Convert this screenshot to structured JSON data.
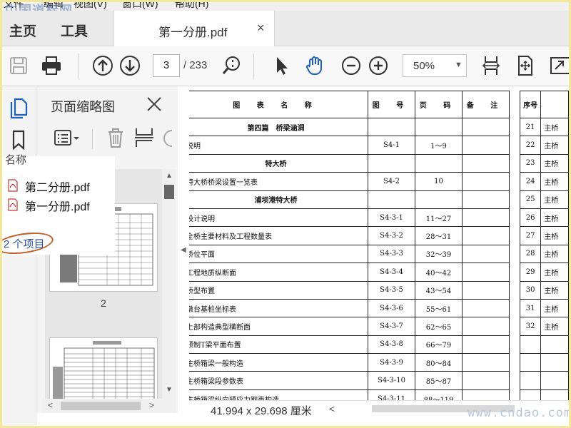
{
  "watermark_top": "中国道标网",
  "watermark_bottom": "www.cndao.com",
  "menu": {
    "items": [
      "文件",
      "编辑",
      "视图(V)",
      "窗口(W)",
      "帮助(H)"
    ]
  },
  "tabs": {
    "home": "主页",
    "tools": "工具",
    "doc": "第一分册.pdf",
    "close": "×"
  },
  "toolbar": {
    "current_page": "3",
    "total_pages": "/ 233",
    "zoom": "50%"
  },
  "thumb_panel": {
    "title": "页面缩略图",
    "page_label": "2"
  },
  "file_list": {
    "header": "名称",
    "items": [
      "第二分册.pdf",
      "第一分册.pdf"
    ],
    "count": "2 个项目"
  },
  "status": {
    "page_size": "41.994 x 29.698 厘米"
  },
  "doc_table": {
    "headers": [
      "图 表 名 称",
      "图 号",
      "页 码",
      "备 注"
    ],
    "rows": [
      {
        "name": "第四篇　桥梁涵洞",
        "no": "",
        "page": "",
        "section": true
      },
      {
        "name": "说明",
        "no": "S4-1",
        "page": "1～9",
        "section": false
      },
      {
        "name": "特大桥",
        "no": "",
        "page": "",
        "section": true
      },
      {
        "name": "特大桥桥梁设置一览表",
        "no": "S4-2",
        "page": "10",
        "section": false
      },
      {
        "name": "浦坝港特大桥",
        "no": "",
        "page": "",
        "section": true
      },
      {
        "name": "设计说明",
        "no": "S4-3-1",
        "page": "11～27",
        "section": false
      },
      {
        "name": "全桥主要材料及工程数量表",
        "no": "S4-3-2",
        "page": "28～31",
        "section": false
      },
      {
        "name": "桥位平面",
        "no": "S4-3-3",
        "page": "32～39",
        "section": false
      },
      {
        "name": "工程地质纵断面",
        "no": "S4-3-4",
        "page": "40～42",
        "section": false
      },
      {
        "name": "桥型布置",
        "no": "S4-3-5",
        "page": "43～54",
        "section": false
      },
      {
        "name": "墩台基桩坐标表",
        "no": "S4-3-6",
        "page": "55～61",
        "section": false
      },
      {
        "name": "上部构造典型横断面",
        "no": "S4-3-7",
        "page": "62～65",
        "section": false
      },
      {
        "name": "预制T梁平面布置",
        "no": "S4-3-8",
        "page": "66～79",
        "section": false
      },
      {
        "name": "主桥箱梁一般构造",
        "no": "S4-3-9",
        "page": "80～84",
        "section": false
      },
      {
        "name": "主桥箱梁段参数表",
        "no": "S4-3-10",
        "page": "85～87",
        "section": false
      },
      {
        "name": "主桥箱梁纵向预应力钢束构造",
        "no": "S4-3-11",
        "page": "88～119",
        "section": false
      }
    ]
  },
  "doc_table2": {
    "header": "序号",
    "rows": [
      {
        "n": "21",
        "t": "主桥"
      },
      {
        "n": "22",
        "t": "主桥"
      },
      {
        "n": "23",
        "t": "主桥"
      },
      {
        "n": "24",
        "t": "主桥"
      },
      {
        "n": "25",
        "t": "主桥"
      },
      {
        "n": "26",
        "t": "主桥"
      },
      {
        "n": "27",
        "t": "主桥"
      },
      {
        "n": "28",
        "t": "主桥"
      },
      {
        "n": "29",
        "t": "主桥"
      },
      {
        "n": "30",
        "t": "主桥"
      },
      {
        "n": "31",
        "t": "主桥"
      },
      {
        "n": "32",
        "t": "主桥"
      },
      {
        "n": "",
        "t": ""
      },
      {
        "n": "",
        "t": ""
      },
      {
        "n": "",
        "t": ""
      },
      {
        "n": "",
        "t": ""
      }
    ]
  },
  "colors": {
    "border": "#f2e79a",
    "oval": "#c0602a",
    "accent": "#2a4ea0"
  }
}
